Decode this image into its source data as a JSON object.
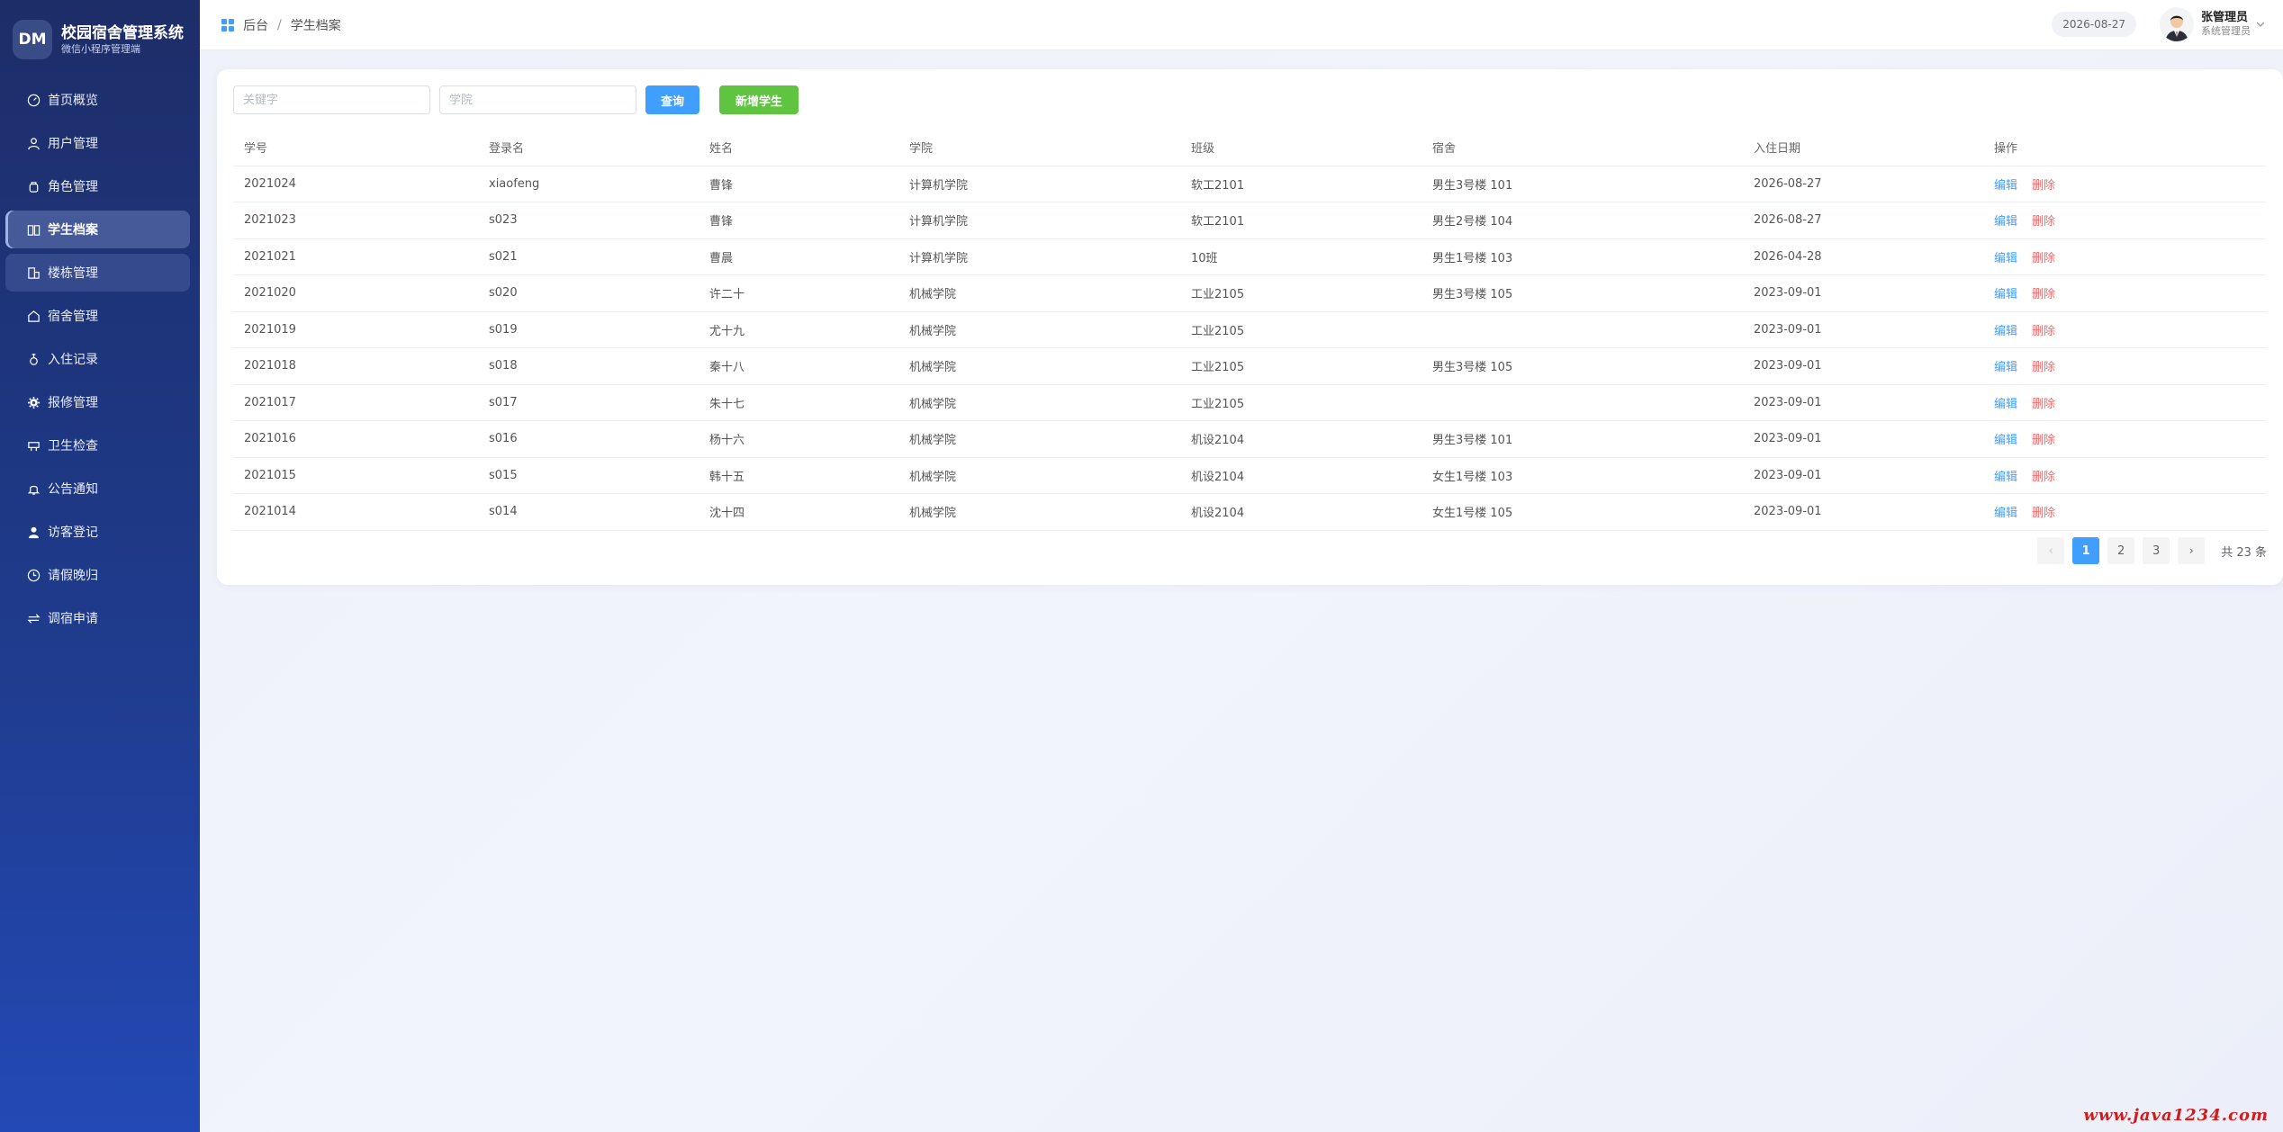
{
  "brand": {
    "logo": "DM",
    "title": "校园宿舍管理系统",
    "subtitle": "微信小程序管理端"
  },
  "sidebar": {
    "items": [
      {
        "label": "首页概览",
        "icon": "dashboard-icon"
      },
      {
        "label": "用户管理",
        "icon": "user-icon"
      },
      {
        "label": "角色管理",
        "icon": "role-icon"
      },
      {
        "label": "学生档案",
        "icon": "book-icon",
        "active": true
      },
      {
        "label": "楼栋管理",
        "icon": "building-icon",
        "hover": true
      },
      {
        "label": "宿舍管理",
        "icon": "home-icon"
      },
      {
        "label": "入住记录",
        "icon": "checkin-icon"
      },
      {
        "label": "报修管理",
        "icon": "gear-icon"
      },
      {
        "label": "卫生检查",
        "icon": "clean-icon"
      },
      {
        "label": "公告通知",
        "icon": "bell-icon"
      },
      {
        "label": "访客登记",
        "icon": "visitor-icon"
      },
      {
        "label": "请假晚归",
        "icon": "clock-icon"
      },
      {
        "label": "调宿申请",
        "icon": "swap-icon"
      }
    ]
  },
  "header": {
    "breadcrumb": {
      "root": "后台",
      "sep": "/",
      "current": "学生档案"
    },
    "date": "2026-08-27",
    "user": {
      "name": "张管理员",
      "role": "系统管理员"
    }
  },
  "search": {
    "keyword_placeholder": "关键字",
    "college_placeholder": "学院",
    "query_label": "查询",
    "add_label": "新增学生"
  },
  "table": {
    "headers": [
      "学号",
      "登录名",
      "姓名",
      "学院",
      "班级",
      "宿舍",
      "入住日期",
      "操作"
    ],
    "rows": [
      [
        "2021024",
        "xiaofeng",
        "曹锋",
        "计算机学院",
        "软工2101",
        "男生3号楼 101",
        "2026-08-27"
      ],
      [
        "2021023",
        "s023",
        "曹锋",
        "计算机学院",
        "软工2101",
        "男生2号楼 104",
        "2026-08-27"
      ],
      [
        "2021021",
        "s021",
        "曹晨",
        "计算机学院",
        "10班",
        "男生1号楼 103",
        "2026-04-28"
      ],
      [
        "2021020",
        "s020",
        "许二十",
        "机械学院",
        "工业2105",
        "男生3号楼 105",
        "2023-09-01"
      ],
      [
        "2021019",
        "s019",
        "尤十九",
        "机械学院",
        "工业2105",
        "",
        "2023-09-01"
      ],
      [
        "2021018",
        "s018",
        "秦十八",
        "机械学院",
        "工业2105",
        "男生3号楼 105",
        "2023-09-01"
      ],
      [
        "2021017",
        "s017",
        "朱十七",
        "机械学院",
        "工业2105",
        "",
        "2023-09-01"
      ],
      [
        "2021016",
        "s016",
        "杨十六",
        "机械学院",
        "机设2104",
        "男生3号楼 101",
        "2023-09-01"
      ],
      [
        "2021015",
        "s015",
        "韩十五",
        "机械学院",
        "机设2104",
        "女生1号楼 103",
        "2023-09-01"
      ],
      [
        "2021014",
        "s014",
        "沈十四",
        "机械学院",
        "机设2104",
        "女生1号楼 105",
        "2023-09-01"
      ]
    ],
    "edit_label": "编辑",
    "delete_label": "删除"
  },
  "pagination": {
    "prev": "‹",
    "pages": [
      "1",
      "2",
      "3"
    ],
    "current": "1",
    "next": "›",
    "total": "共 23 条"
  },
  "watermark": "www.java1234.com",
  "colors": {
    "primary": "#409eff",
    "success": "#5fc43f",
    "danger": "#f56c6c",
    "sidebar": "#1f3c8f"
  }
}
